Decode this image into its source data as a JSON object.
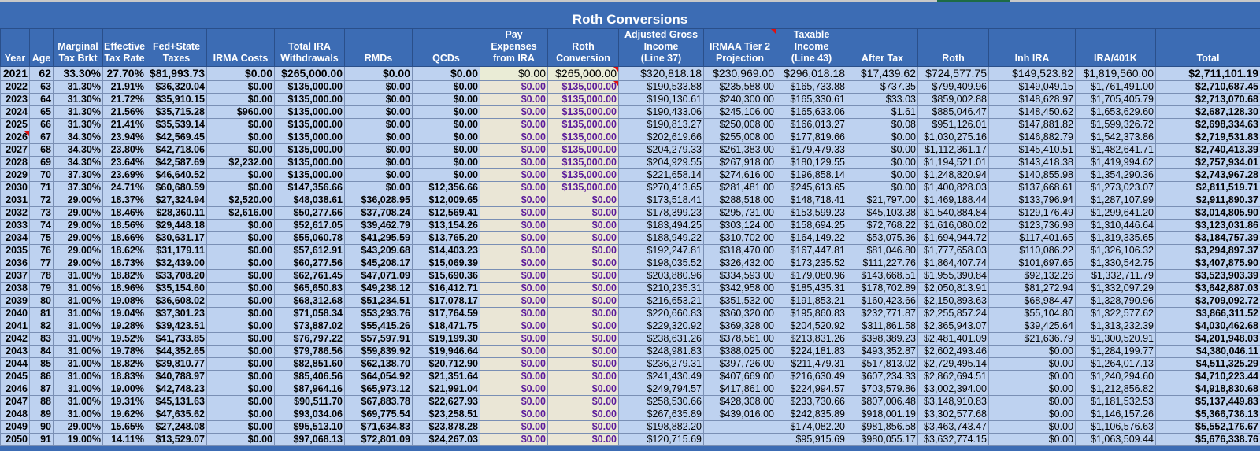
{
  "title": "Roth Conversions",
  "columns": [
    "Year",
    "Age",
    "Marginal Tax Brkt",
    "Effective Tax Rate",
    "Fed+State Taxes",
    "IRMA Costs",
    "Total IRA Withdrawals",
    "RMDs",
    "QCDs",
    "Pay Expenses from IRA",
    "Roth Conversion",
    "Adjusted Gross Income (Line 37)",
    "IRMAA Tier 2 Projection",
    "Taxable Income (Line 43)",
    "After Tax",
    "Roth",
    "Inh IRA",
    "IRA/401K",
    "Total"
  ],
  "column_lines": [
    [
      "Year"
    ],
    [
      "Age"
    ],
    [
      "Marginal",
      "Tax Brkt"
    ],
    [
      "Effective",
      "Tax Rate"
    ],
    [
      "Fed+State",
      "Taxes"
    ],
    [
      "IRMA Costs"
    ],
    [
      "Total IRA",
      "Withdrawals"
    ],
    [
      "RMDs"
    ],
    [
      "QCDs"
    ],
    [
      "Pay Expenses",
      "from IRA"
    ],
    [
      "Roth",
      "Conversion"
    ],
    [
      "Adjusted Gross",
      "Income",
      "(Line 37)"
    ],
    [
      "IRMAA Tier 2",
      "Projection"
    ],
    [
      "Taxable",
      "Income",
      "(Line 43)"
    ],
    [
      "After Tax"
    ],
    [
      "Roth"
    ],
    [
      "Inh IRA"
    ],
    [
      "IRA/401K"
    ],
    [
      "Total"
    ]
  ],
  "rows": [
    [
      "2021",
      "62",
      "33.30%",
      "27.70%",
      "$81,993.73",
      "$0.00",
      "$265,000.00",
      "$0.00",
      "$0.00",
      "$0.00",
      "$265,000.00",
      "$320,818.18",
      "$230,969.00",
      "$296,018.18",
      "$17,439.62",
      "$724,577.75",
      "$149,523.82",
      "$1,819,560.00",
      "$2,711,101.19"
    ],
    [
      "2022",
      "63",
      "31.30%",
      "21.91%",
      "$36,320.04",
      "$0.00",
      "$135,000.00",
      "$0.00",
      "$0.00",
      "$0.00",
      "$135,000.00",
      "$190,533.88",
      "$235,588.00",
      "$165,733.88",
      "$737.35",
      "$799,409.96",
      "$149,049.15",
      "$1,761,491.00",
      "$2,710,687.45"
    ],
    [
      "2023",
      "64",
      "31.30%",
      "21.72%",
      "$35,910.15",
      "$0.00",
      "$135,000.00",
      "$0.00",
      "$0.00",
      "$0.00",
      "$135,000.00",
      "$190,130.61",
      "$240,300.00",
      "$165,330.61",
      "$33.03",
      "$859,002.88",
      "$148,628.97",
      "$1,705,405.79",
      "$2,713,070.68"
    ],
    [
      "2024",
      "65",
      "31.30%",
      "21.56%",
      "$35,715.28",
      "$960.00",
      "$135,000.00",
      "$0.00",
      "$0.00",
      "$0.00",
      "$135,000.00",
      "$190,433.06",
      "$245,106.00",
      "$165,633.06",
      "$1.61",
      "$885,046.47",
      "$148,450.62",
      "$1,653,629.60",
      "$2,687,128.30"
    ],
    [
      "2025",
      "66",
      "31.30%",
      "21.41%",
      "$35,539.14",
      "$0.00",
      "$135,000.00",
      "$0.00",
      "$0.00",
      "$0.00",
      "$135,000.00",
      "$190,813.27",
      "$250,008.00",
      "$166,013.27",
      "$0.08",
      "$951,126.01",
      "$147,881.82",
      "$1,599,326.72",
      "$2,698,334.63"
    ],
    [
      "2026",
      "67",
      "34.30%",
      "23.94%",
      "$42,569.45",
      "$0.00",
      "$135,000.00",
      "$0.00",
      "$0.00",
      "$0.00",
      "$135,000.00",
      "$202,619.66",
      "$255,008.00",
      "$177,819.66",
      "$0.00",
      "$1,030,275.16",
      "$146,882.79",
      "$1,542,373.86",
      "$2,719,531.83"
    ],
    [
      "2027",
      "68",
      "34.30%",
      "23.80%",
      "$42,718.06",
      "$0.00",
      "$135,000.00",
      "$0.00",
      "$0.00",
      "$0.00",
      "$135,000.00",
      "$204,279.33",
      "$261,383.00",
      "$179,479.33",
      "$0.00",
      "$1,112,361.17",
      "$145,410.51",
      "$1,482,641.71",
      "$2,740,413.39"
    ],
    [
      "2028",
      "69",
      "34.30%",
      "23.64%",
      "$42,587.69",
      "$2,232.00",
      "$135,000.00",
      "$0.00",
      "$0.00",
      "$0.00",
      "$135,000.00",
      "$204,929.55",
      "$267,918.00",
      "$180,129.55",
      "$0.00",
      "$1,194,521.01",
      "$143,418.38",
      "$1,419,994.62",
      "$2,757,934.01"
    ],
    [
      "2029",
      "70",
      "37.30%",
      "23.69%",
      "$46,640.52",
      "$0.00",
      "$135,000.00",
      "$0.00",
      "$0.00",
      "$0.00",
      "$135,000.00",
      "$221,658.14",
      "$274,616.00",
      "$196,858.14",
      "$0.00",
      "$1,248,820.94",
      "$140,855.98",
      "$1,354,290.36",
      "$2,743,967.28"
    ],
    [
      "2030",
      "71",
      "37.30%",
      "24.71%",
      "$60,680.59",
      "$0.00",
      "$147,356.66",
      "$0.00",
      "$12,356.66",
      "$0.00",
      "$135,000.00",
      "$270,413.65",
      "$281,481.00",
      "$245,613.65",
      "$0.00",
      "$1,400,828.03",
      "$137,668.61",
      "$1,273,023.07",
      "$2,811,519.71"
    ],
    [
      "2031",
      "72",
      "29.00%",
      "18.37%",
      "$27,324.94",
      "$2,520.00",
      "$48,038.61",
      "$36,028.95",
      "$12,009.65",
      "$0.00",
      "$0.00",
      "$173,518.41",
      "$288,518.00",
      "$148,718.41",
      "$21,797.00",
      "$1,469,188.44",
      "$133,796.94",
      "$1,287,107.99",
      "$2,911,890.37"
    ],
    [
      "2032",
      "73",
      "29.00%",
      "18.46%",
      "$28,360.11",
      "$2,616.00",
      "$50,277.66",
      "$37,708.24",
      "$12,569.41",
      "$0.00",
      "$0.00",
      "$178,399.23",
      "$295,731.00",
      "$153,599.23",
      "$45,103.38",
      "$1,540,884.84",
      "$129,176.49",
      "$1,299,641.20",
      "$3,014,805.90"
    ],
    [
      "2033",
      "74",
      "29.00%",
      "18.56%",
      "$29,448.18",
      "$0.00",
      "$52,617.05",
      "$39,462.79",
      "$13,154.26",
      "$0.00",
      "$0.00",
      "$183,494.25",
      "$303,124.00",
      "$158,694.25",
      "$72,768.22",
      "$1,616,080.02",
      "$123,736.98",
      "$1,310,446.64",
      "$3,123,031.86"
    ],
    [
      "2034",
      "75",
      "29.00%",
      "18.66%",
      "$30,631.17",
      "$0.00",
      "$55,060.78",
      "$41,295.59",
      "$13,765.20",
      "$0.00",
      "$0.00",
      "$188,949.22",
      "$310,702.00",
      "$164,149.22",
      "$53,075.36",
      "$1,694,944.72",
      "$117,401.65",
      "$1,319,335.65",
      "$3,184,757.39"
    ],
    [
      "2035",
      "76",
      "29.00%",
      "18.62%",
      "$31,179.11",
      "$0.00",
      "$57,612.91",
      "$43,209.68",
      "$14,403.23",
      "$0.00",
      "$0.00",
      "$192,247.81",
      "$318,470.00",
      "$167,447.81",
      "$81,046.80",
      "$1,777,658.03",
      "$110,086.22",
      "$1,326,106.32",
      "$3,294,897.37"
    ],
    [
      "2036",
      "77",
      "29.00%",
      "18.73%",
      "$32,439.00",
      "$0.00",
      "$60,277.56",
      "$45,208.17",
      "$15,069.39",
      "$0.00",
      "$0.00",
      "$198,035.52",
      "$326,432.00",
      "$173,235.52",
      "$111,227.76",
      "$1,864,407.74",
      "$101,697.65",
      "$1,330,542.75",
      "$3,407,875.90"
    ],
    [
      "2037",
      "78",
      "31.00%",
      "18.82%",
      "$33,708.20",
      "$0.00",
      "$62,761.45",
      "$47,071.09",
      "$15,690.36",
      "$0.00",
      "$0.00",
      "$203,880.96",
      "$334,593.00",
      "$179,080.96",
      "$143,668.51",
      "$1,955,390.84",
      "$92,132.26",
      "$1,332,711.79",
      "$3,523,903.39"
    ],
    [
      "2038",
      "79",
      "31.00%",
      "18.96%",
      "$35,154.60",
      "$0.00",
      "$65,650.83",
      "$49,238.12",
      "$16,412.71",
      "$0.00",
      "$0.00",
      "$210,235.31",
      "$342,958.00",
      "$185,435.31",
      "$178,702.89",
      "$2,050,813.91",
      "$81,272.94",
      "$1,332,097.29",
      "$3,642,887.03"
    ],
    [
      "2039",
      "80",
      "31.00%",
      "19.08%",
      "$36,608.02",
      "$0.00",
      "$68,312.68",
      "$51,234.51",
      "$17,078.17",
      "$0.00",
      "$0.00",
      "$216,653.21",
      "$351,532.00",
      "$191,853.21",
      "$160,423.66",
      "$2,150,893.63",
      "$68,984.47",
      "$1,328,790.96",
      "$3,709,092.72"
    ],
    [
      "2040",
      "81",
      "31.00%",
      "19.04%",
      "$37,301.23",
      "$0.00",
      "$71,058.34",
      "$53,293.76",
      "$17,764.59",
      "$0.00",
      "$0.00",
      "$220,660.83",
      "$360,320.00",
      "$195,860.83",
      "$232,771.87",
      "$2,255,857.24",
      "$55,104.80",
      "$1,322,577.62",
      "$3,866,311.52"
    ],
    [
      "2041",
      "82",
      "31.00%",
      "19.28%",
      "$39,423.51",
      "$0.00",
      "$73,887.02",
      "$55,415.26",
      "$18,471.75",
      "$0.00",
      "$0.00",
      "$229,320.92",
      "$369,328.00",
      "$204,520.92",
      "$311,861.58",
      "$2,365,943.07",
      "$39,425.64",
      "$1,313,232.39",
      "$4,030,462.68"
    ],
    [
      "2042",
      "83",
      "31.00%",
      "19.52%",
      "$41,733.85",
      "$0.00",
      "$76,797.22",
      "$57,597.91",
      "$19,199.30",
      "$0.00",
      "$0.00",
      "$238,631.26",
      "$378,561.00",
      "$213,831.26",
      "$398,389.23",
      "$2,481,401.09",
      "$21,636.79",
      "$1,300,520.91",
      "$4,201,948.03"
    ],
    [
      "2043",
      "84",
      "31.00%",
      "19.78%",
      "$44,352.65",
      "$0.00",
      "$79,786.56",
      "$59,839.92",
      "$19,946.64",
      "$0.00",
      "$0.00",
      "$248,981.83",
      "$388,025.00",
      "$224,181.83",
      "$493,352.87",
      "$2,602,493.46",
      "$0.00",
      "$1,284,199.77",
      "$4,380,046.11"
    ],
    [
      "2044",
      "85",
      "31.00%",
      "18.82%",
      "$39,810.77",
      "$0.00",
      "$82,851.60",
      "$62,138.70",
      "$20,712.90",
      "$0.00",
      "$0.00",
      "$236,279.31",
      "$397,726.00",
      "$211,479.31",
      "$517,813.02",
      "$2,729,495.14",
      "$0.00",
      "$1,264,017.13",
      "$4,511,325.29"
    ],
    [
      "2045",
      "86",
      "31.00%",
      "18.83%",
      "$40,788.97",
      "$0.00",
      "$85,406.56",
      "$64,054.92",
      "$21,351.64",
      "$0.00",
      "$0.00",
      "$241,430.49",
      "$407,669.00",
      "$216,630.49",
      "$607,234.33",
      "$2,862,694.51",
      "$0.00",
      "$1,240,294.60",
      "$4,710,223.44"
    ],
    [
      "2046",
      "87",
      "31.00%",
      "19.00%",
      "$42,748.23",
      "$0.00",
      "$87,964.16",
      "$65,973.12",
      "$21,991.04",
      "$0.00",
      "$0.00",
      "$249,794.57",
      "$417,861.00",
      "$224,994.57",
      "$703,579.86",
      "$3,002,394.00",
      "$0.00",
      "$1,212,856.82",
      "$4,918,830.68"
    ],
    [
      "2047",
      "88",
      "31.00%",
      "19.31%",
      "$45,131.63",
      "$0.00",
      "$90,511.70",
      "$67,883.78",
      "$22,627.93",
      "$0.00",
      "$0.00",
      "$258,530.66",
      "$428,308.00",
      "$233,730.66",
      "$807,006.48",
      "$3,148,910.83",
      "$0.00",
      "$1,181,532.53",
      "$5,137,449.83"
    ],
    [
      "2048",
      "89",
      "31.00%",
      "19.62%",
      "$47,635.62",
      "$0.00",
      "$93,034.06",
      "$69,775.54",
      "$23,258.51",
      "$0.00",
      "$0.00",
      "$267,635.89",
      "$439,016.00",
      "$242,835.89",
      "$918,001.19",
      "$3,302,577.68",
      "$0.00",
      "$1,146,157.26",
      "$5,366,736.13"
    ],
    [
      "2049",
      "90",
      "29.00%",
      "15.65%",
      "$27,248.08",
      "$0.00",
      "$95,513.10",
      "$71,634.83",
      "$23,878.28",
      "$0.00",
      "$0.00",
      "$198,882.20",
      "",
      "$174,082.20",
      "$981,856.58",
      "$3,463,743.47",
      "$0.00",
      "$1,106,576.63",
      "$5,552,176.67"
    ],
    [
      "2050",
      "91",
      "19.00%",
      "14.11%",
      "$13,529.07",
      "$0.00",
      "$97,068.13",
      "$72,801.09",
      "$24,267.03",
      "$0.00",
      "$0.00",
      "$120,715.69",
      "",
      "$95,915.69",
      "$980,055.17",
      "$3,632,774.15",
      "$0.00",
      "$1,063,509.44",
      "$5,676,338.76"
    ]
  ]
}
